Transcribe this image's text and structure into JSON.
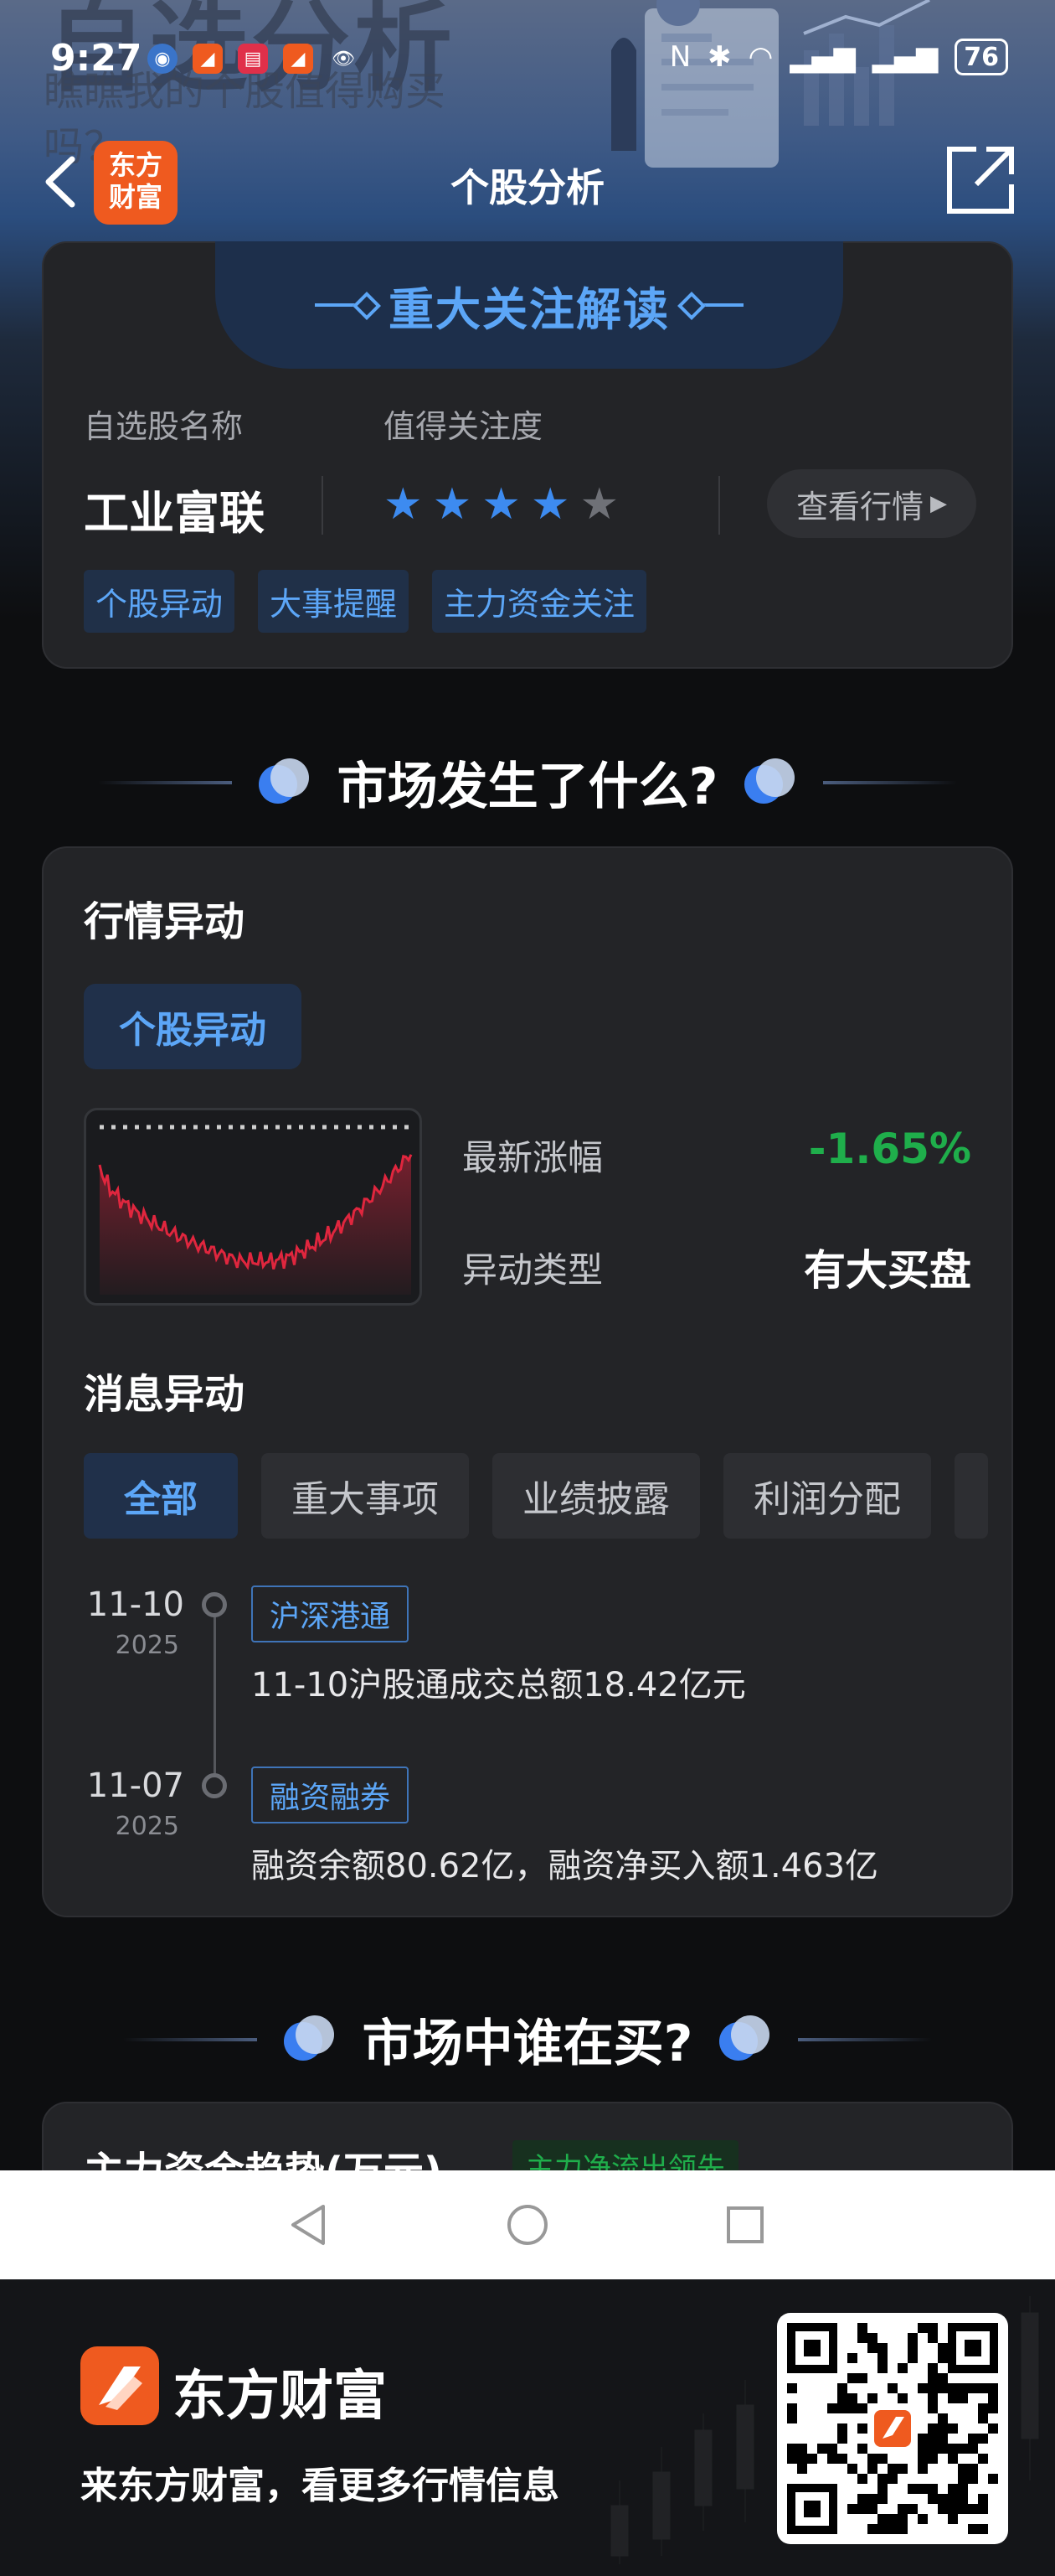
{
  "status_bar": {
    "time": "9:27",
    "battery": "76"
  },
  "hero": {
    "title": "自选分析",
    "subtitle": "瞧瞧我的个股值得购买吗？"
  },
  "nav": {
    "title": "个股分析",
    "logo_text_1": "东方",
    "logo_text_2": "财富"
  },
  "focus_card": {
    "heading": "重大关注解读",
    "name_label": "自选股名称",
    "attention_label": "值得关注度",
    "stock_name": "工业富联",
    "rating": 4,
    "rating_max": 5,
    "view_button": "查看行情",
    "tags": [
      "个股异动",
      "大事提醒",
      "主力资金关注"
    ]
  },
  "section1": {
    "title": "市场发生了什么?"
  },
  "market_card": {
    "title": "行情异动",
    "pill": "个股异动",
    "latest_change_label": "最新涨幅",
    "latest_change_value": "-1.65%",
    "anomaly_type_label": "异动类型",
    "anomaly_type_value": "有大买盘",
    "news_title": "消息异动",
    "filters": [
      "全部",
      "重大事项",
      "业绩披露",
      "利润分配"
    ],
    "timeline": [
      {
        "date": "11-10",
        "year": "2025",
        "tag": "沪深港通",
        "text": "11-10沪股通成交总额18.42亿元"
      },
      {
        "date": "11-07",
        "year": "2025",
        "tag": "融资融券",
        "text": "融资余额80.62亿，融资净买入额1.463亿"
      }
    ]
  },
  "section2": {
    "title": "市场中谁在买?"
  },
  "capital_card": {
    "title": "主力资金趋势(万元)",
    "badge": "主力净流出领先"
  },
  "footer": {
    "brand": "东方财富",
    "slogan": "来东方财富，看更多行情信息"
  },
  "colors": {
    "accent": "#5ca6f7",
    "down": "#1fae4b",
    "brand": "#ef5a1f"
  }
}
